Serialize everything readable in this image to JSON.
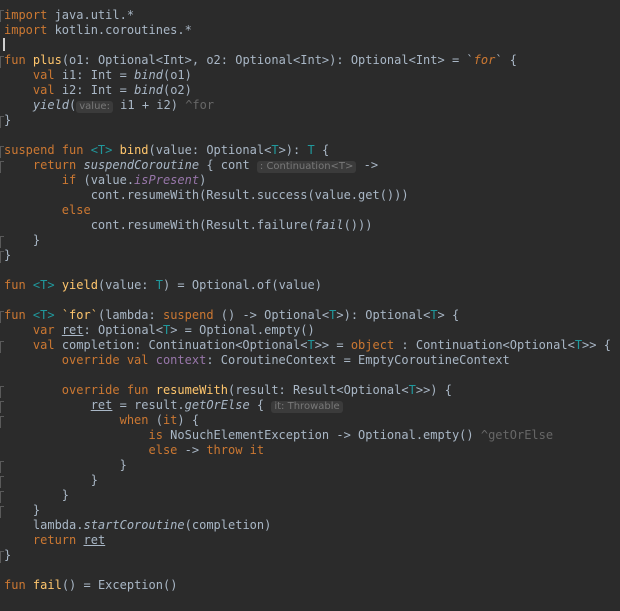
{
  "editor": {
    "imports": [
      {
        "kw": "import",
        "path": " java.util.*"
      },
      {
        "kw": "import",
        "path": " kotlin.coroutines.*"
      }
    ],
    "plus": {
      "l1": {
        "kw": "fun",
        "name": "plus",
        "sig": "(o1: Optional<Int>, o2: Optional<Int>): Optional<Int> = `",
        "tick": "for",
        "end": "` {"
      },
      "l2": {
        "kw": "val",
        "rest": " i1: Int = ",
        "call": "bind",
        "arg": "(o1)"
      },
      "l3": {
        "kw": "val",
        "rest": " i2: Int = ",
        "call": "bind",
        "arg": "(o2)"
      },
      "l4": {
        "call": "yield",
        "open": "(",
        "hint": "value:",
        "rest": " i1 + i2) ",
        "tail": "^for"
      },
      "l5": "}"
    },
    "bind": {
      "l1": {
        "kw1": "suspend",
        "kw2": " fun ",
        "tp": "<T>",
        "name": " bind",
        "sig": "(value: Optional<",
        "tp2": "T",
        "sig2": ">): ",
        "tp3": "T",
        "end": " {"
      },
      "l2": {
        "kw": "return",
        "call": " suspendCoroutine",
        "rest": " { cont ",
        "hint": ": Continuation<T>",
        "arrow": " ->"
      },
      "l3": {
        "kw": "if",
        "rest": " (value.",
        "prop": "isPresent",
        "end": ")"
      },
      "l4": "cont.resumeWith(Result.success(value.get()))",
      "l5": "else",
      "l6": {
        "pre": "cont.resumeWith(Result.failure(",
        "call": "fail",
        "post": "()))"
      },
      "l7": "}",
      "l8": "}"
    },
    "yield": {
      "kw": "fun",
      "tp": " <T>",
      "name": " yield",
      "sig": "(value: ",
      "tp2": "T",
      "rest": ") = Optional.of(value)"
    },
    "forFn": {
      "l1": {
        "kw": "fun",
        "tp": " <T>",
        "sp": " ",
        "name": "`for`",
        "sig": "(lambda: ",
        "kw2": "suspend",
        "mid": " () -> Optional<",
        "tp2": "T",
        "mid2": ">): Optional<",
        "tp3": "T",
        "end": "> {"
      },
      "l2": {
        "kw": "var",
        "sp": " ",
        "var": "ret",
        "mid": ": Optional<",
        "tp": "T",
        "rest": "> = Optional.empty()"
      },
      "l3": {
        "kw": "val",
        "mid": " completion: Continuation<Optional<",
        "tp": "T",
        "mid2": ">> = ",
        "kw2": "object",
        "mid3": " : Continuation<Optional<",
        "tp2": "T",
        "end": ">> {"
      },
      "l4": {
        "kw": "override val",
        "sp": " ",
        "prop": "context",
        "rest": ": CoroutineContext = EmptyCoroutineContext"
      },
      "l5": {
        "kw": "override fun",
        "name": " resumeWith",
        "mid": "(result: Result<Optional<",
        "tp": "T",
        "end": ">>) {"
      },
      "l6": {
        "var": "ret",
        "mid": " = result.",
        "call": "getOrElse",
        "rest": " { ",
        "hint": "it: Throwable"
      },
      "l7": {
        "kw": "when",
        "rest": " (",
        "kw2": "it",
        "end": ") {"
      },
      "l8": {
        "kw": "is",
        "rest": " NoSuchElementException -> Optional.empty() ",
        "tail": "^getOrElse"
      },
      "l9": {
        "kw": "else",
        "rest": " -> ",
        "kw2": "throw",
        "sp": " ",
        "kw3": "it"
      },
      "l10": "}",
      "l11": "}",
      "l12": "}",
      "l13": "}",
      "l14": {
        "pre": "lambda.",
        "call": "startCoroutine",
        "rest": "(completion)"
      },
      "l15": {
        "kw": "return",
        "sp": " ",
        "var": "ret"
      },
      "l16": "}"
    },
    "fail": {
      "kw": "fun",
      "sp": " ",
      "name": "fail",
      "rest": "() = Exception()"
    }
  }
}
